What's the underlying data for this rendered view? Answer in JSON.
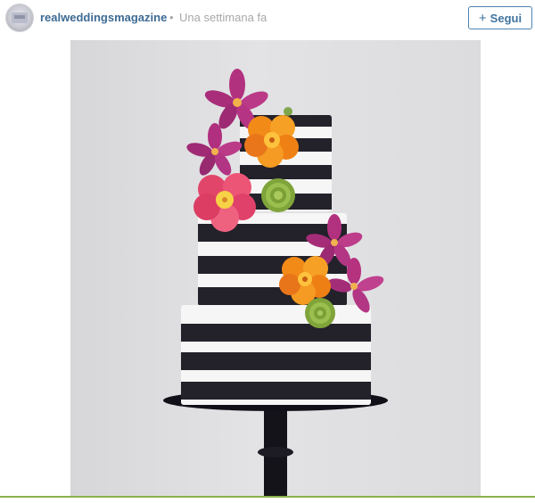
{
  "post": {
    "username": "realweddingsmagazine",
    "separator": "•",
    "time": "Una settimana fa",
    "follow_label": "Segui",
    "follow_icon": "plus-icon"
  },
  "colors": {
    "username": "#3d6a94",
    "follow_border": "#4d83b3",
    "stripe_dark": "#23212a",
    "stripe_light": "#f6f6f6",
    "bottom_line": "#8ab24a"
  }
}
